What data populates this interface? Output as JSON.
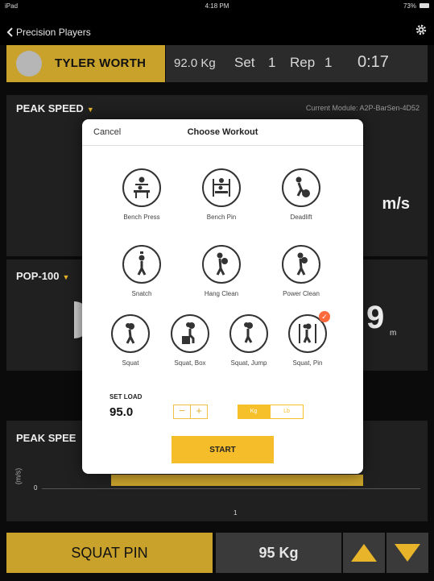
{
  "status_bar": {
    "device": "iPad",
    "time": "4:18 PM",
    "battery": "73%"
  },
  "nav": {
    "back_label": "Precision Players"
  },
  "athlete": {
    "name": "TYLER WORTH",
    "weight": "92.0 Kg",
    "set_label": "Set",
    "set_value": "1",
    "rep_label": "Rep",
    "rep_value": "1",
    "timer": "0:17"
  },
  "peak_speed": {
    "title": "PEAK SPEED",
    "module": "Current Module: A2P-BarSen-4D52",
    "unit": "m/s"
  },
  "pop100": {
    "title": "POP-100",
    "value_tail": "9",
    "unit": "m"
  },
  "peak_speed_chart": {
    "title": "PEAK SPEE",
    "y_unit": "(m/s)",
    "y_zero": "0",
    "x_tick": "1"
  },
  "modal": {
    "cancel": "Cancel",
    "title": "Choose Workout",
    "workouts": [
      {
        "label": "Bench Press",
        "icon": "bench-press-icon"
      },
      {
        "label": "Bench Pin",
        "icon": "bench-pin-icon"
      },
      {
        "label": "Deadlift",
        "icon": "deadlift-icon"
      },
      {
        "label": "Snatch",
        "icon": "snatch-icon"
      },
      {
        "label": "Hang Clean",
        "icon": "hang-clean-icon"
      },
      {
        "label": "Power Clean",
        "icon": "power-clean-icon"
      },
      {
        "label": "Squat",
        "icon": "squat-icon"
      },
      {
        "label": "Squat, Box",
        "icon": "squat-box-icon"
      },
      {
        "label": "Squat, Jump",
        "icon": "squat-jump-icon"
      },
      {
        "label": "Squat, Pin",
        "icon": "squat-pin-icon"
      }
    ],
    "selected": "Squat, Pin",
    "set_load_label": "SET LOAD",
    "set_load_value": "95.0",
    "minus": "−",
    "plus": "+",
    "unit_kg": "Kg",
    "unit_lb": "Lb",
    "start": "START"
  },
  "bottom": {
    "exercise": "SQUAT PIN",
    "load": "95 Kg"
  },
  "colors": {
    "accent": "#c9a22c",
    "modal_accent": "#f5bd2a",
    "check": "#ff6a3d"
  }
}
